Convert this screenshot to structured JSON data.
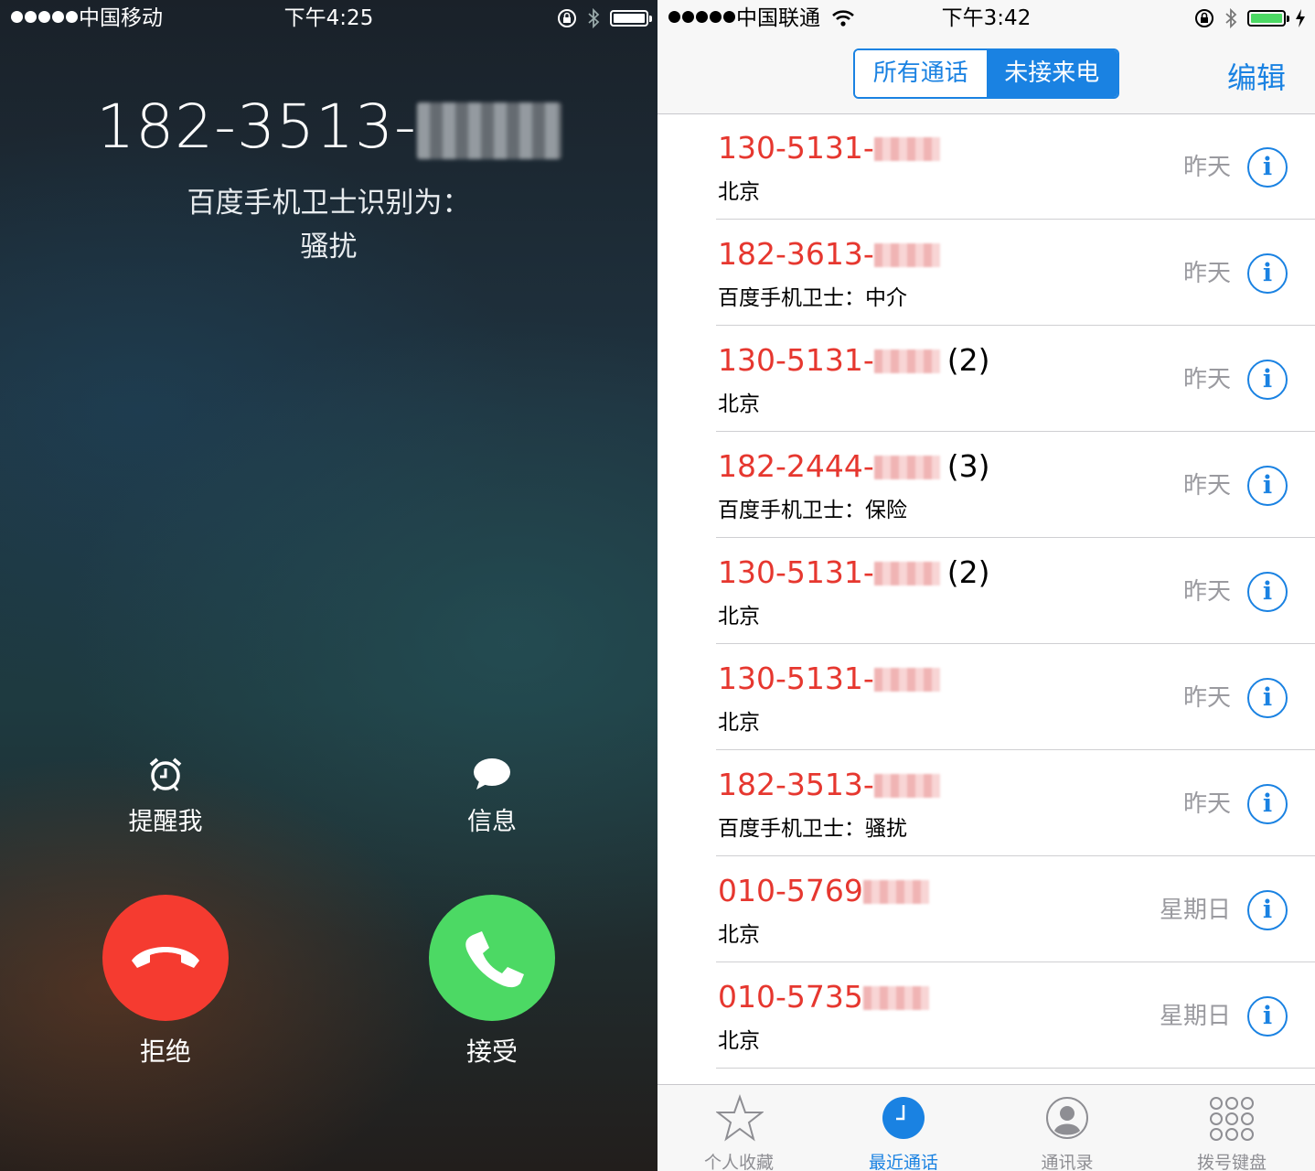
{
  "incoming": {
    "status_bar": {
      "carrier": "中国移动",
      "time": "下午4:25"
    },
    "caller_number": "182-3513-",
    "identified_by": "百度手机卫士识别为：",
    "identified_label": "骚扰",
    "remind_label": "提醒我",
    "message_label": "信息",
    "decline_label": "拒绝",
    "accept_label": "接受",
    "colors": {
      "decline": "#f53b30",
      "accept": "#4cd964"
    }
  },
  "recents": {
    "status_bar": {
      "carrier": "中国联通",
      "time": "下午3:42"
    },
    "segments": {
      "all": "所有通话",
      "missed": "未接来电",
      "selected": "missed"
    },
    "edit_label": "编辑",
    "rows": [
      {
        "number": "130-5131-",
        "count": "",
        "sub": "北京",
        "date": "昨天"
      },
      {
        "number": "182-3613-",
        "count": "",
        "sub": "百度手机卫士：中介",
        "date": "昨天"
      },
      {
        "number": "130-5131-",
        "count": "(2)",
        "sub": "北京",
        "date": "昨天"
      },
      {
        "number": "182-2444-",
        "count": "(3)",
        "sub": "百度手机卫士：保险",
        "date": "昨天"
      },
      {
        "number": "130-5131-",
        "count": "(2)",
        "sub": "北京",
        "date": "昨天"
      },
      {
        "number": "130-5131-",
        "count": "",
        "sub": "北京",
        "date": "昨天"
      },
      {
        "number": "182-3513-",
        "count": "",
        "sub": "百度手机卫士：骚扰",
        "date": "昨天"
      },
      {
        "number": "010-5769",
        "count": "",
        "sub": "北京",
        "date": "星期日"
      },
      {
        "number": "010-5735",
        "count": "",
        "sub": "北京",
        "date": "星期日"
      }
    ],
    "tabs": [
      {
        "label": "个人收藏",
        "icon": "star-icon"
      },
      {
        "label": "最近通话",
        "icon": "clock-icon",
        "active": true
      },
      {
        "label": "通讯录",
        "icon": "contacts-icon"
      },
      {
        "label": "拨号键盘",
        "icon": "keypad-icon"
      }
    ],
    "colors": {
      "accent": "#1a82e2",
      "missed": "#e6372f",
      "battery": "#4cd964"
    }
  }
}
